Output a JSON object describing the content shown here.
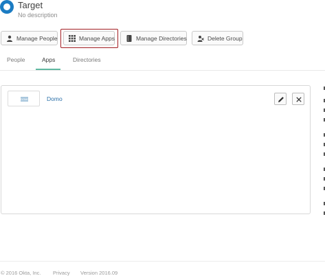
{
  "group": {
    "title": "Target",
    "description": "No description"
  },
  "toolbar": {
    "manage_people": "Manage People",
    "manage_apps": "Manage Apps",
    "manage_directories": "Manage Directories",
    "delete_group": "Delete Group"
  },
  "tabs": {
    "people": "People",
    "apps": "Apps",
    "directories": "Directories",
    "active": "Apps"
  },
  "apps": [
    {
      "name": "Domo",
      "logo_text": "DOMO"
    }
  ],
  "footer": {
    "copyright": "© 2016 Okta, Inc.",
    "privacy": "Privacy",
    "version": "Version 2016.09"
  },
  "colors": {
    "accent": "#1b7cc3",
    "focus_ring": "#a11b20",
    "tab_underline": "#5fb8a0",
    "link": "#2a6fa8"
  },
  "icons": {
    "people_button": "person-icon",
    "apps_button": "grid-icon",
    "directories_button": "book-icon",
    "delete_button": "user-remove-icon",
    "edit_app": "pencil-icon",
    "remove_app": "close-icon"
  }
}
